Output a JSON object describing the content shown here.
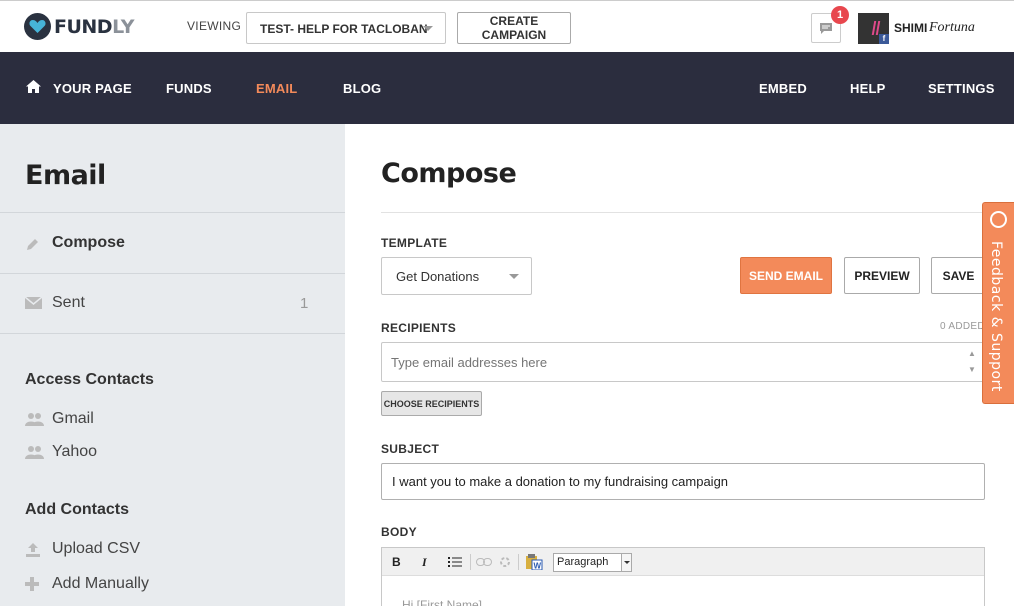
{
  "topbar": {
    "logo_text_a": "FUND",
    "logo_text_b": "LY",
    "viewing_label": "VIEWING",
    "campaign_selected": "TEST- HELP FOR TACLOBAN",
    "create_campaign_label": "CREATE CAMPAIGN",
    "notification_count": "1",
    "user_first": "SHIMI",
    "user_last": "Fortuna"
  },
  "nav": {
    "items_left": [
      "YOUR PAGE",
      "FUNDS",
      "EMAIL",
      "BLOG"
    ],
    "active": "EMAIL",
    "items_right": [
      "EMBED",
      "HELP",
      "SETTINGS"
    ]
  },
  "sidebar": {
    "title": "Email",
    "compose_label": "Compose",
    "sent_label": "Sent",
    "sent_count": "1",
    "access_contacts_heading": "Access Contacts",
    "gmail_label": "Gmail",
    "yahoo_label": "Yahoo",
    "add_contacts_heading": "Add Contacts",
    "upload_csv_label": "Upload CSV",
    "add_manually_label": "Add Manually"
  },
  "compose": {
    "title": "Compose",
    "template_label": "TEMPLATE",
    "template_selected": "Get Donations",
    "send_email_label": "SEND EMAIL",
    "preview_label": "PREVIEW",
    "save_label": "SAVE",
    "recipients_label": "RECIPIENTS",
    "added_count_text": "0 ADDED",
    "recipients_placeholder": "Type email addresses here",
    "choose_recipients_label": "CHOOSE RECIPIENTS",
    "subject_label": "SUBJECT",
    "subject_value": "I want you to make a donation to my fundraising campaign",
    "body_label": "BODY",
    "format_selected": "Paragraph",
    "body_preview": "Hi [First Name],"
  },
  "feedback_label": "Feedback & Support",
  "colors": {
    "accent": "#f38a5a",
    "nav_bg": "#2b2d3e",
    "sidebar_bg": "#e8ebee",
    "badge": "#e8474e"
  }
}
